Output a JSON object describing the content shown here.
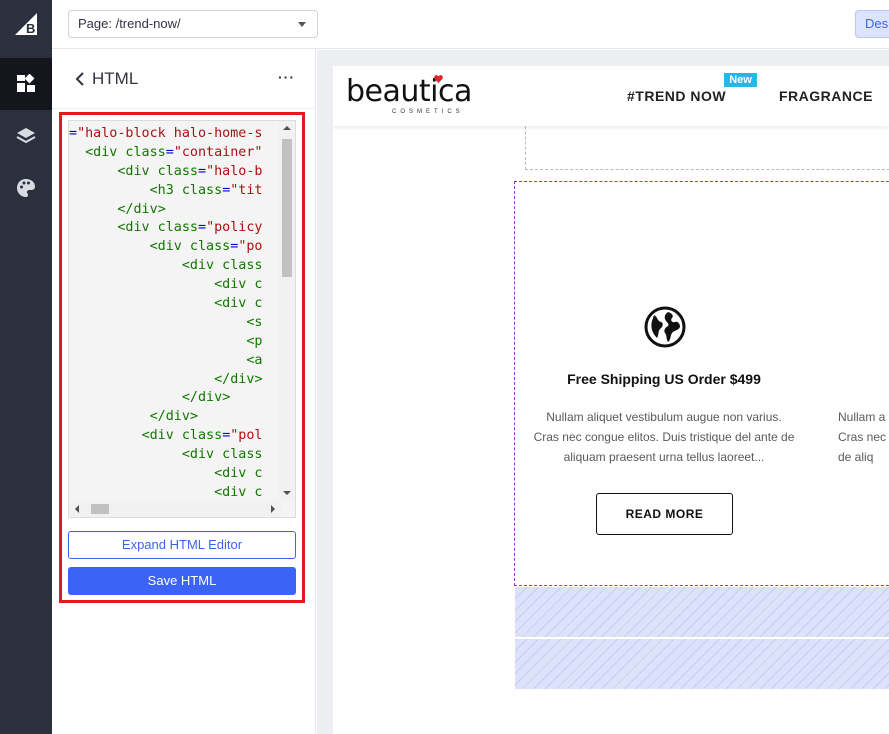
{
  "topbar": {
    "page_select": "Page: /trend-now/",
    "design_button": "Desi"
  },
  "rail": {
    "items": [
      {
        "name": "bigcommerce-logo"
      },
      {
        "name": "widgets-icon",
        "active": true
      },
      {
        "name": "layers-icon"
      },
      {
        "name": "palette-icon"
      }
    ]
  },
  "panel": {
    "back_label": "HTML",
    "more": "···",
    "code_lines": [
      "=\"halo-block halo-home-s",
      "  <div class=\"container\"",
      "      <div class=\"halo-b",
      "          <h3 class=\"tit",
      "      </div>",
      "      <div class=\"policy",
      "          <div class=\"po",
      "              <div class",
      "                  <div c",
      "                  <div c",
      "                      <s",
      "                      <p",
      "                      <a",
      "                  </div>",
      "              </div>",
      "          </div>",
      "         <div class=\"pol",
      "              <div class",
      "                  <div c",
      "                  <div c"
    ],
    "expand_button": "Expand HTML Editor",
    "save_button": "Save HTML"
  },
  "preview": {
    "brand": "beautica",
    "brand_sub": "COSMETICS",
    "nav": [
      {
        "label": "#TREND NOW",
        "badge": "New"
      },
      {
        "label": "FRAGRANCE"
      }
    ],
    "policy": {
      "title": "Free Shipping US Order $499",
      "text": "Nullam aliquet vestibulum augue non varius. Cras nec congue elitos. Duis tristique del ante de aliquam praesent urna tellus laoreet...",
      "text_partial": [
        "Nullam a",
        "Cras nec",
        "de aliq"
      ],
      "button": "READ MORE"
    }
  },
  "colors": {
    "rail_bg": "#2c2f3e",
    "accent": "#3c64f4",
    "highlight": "#e01b1b",
    "badge": "#2ab5e8",
    "heart": "#e0242c",
    "selection_dash": "#9b30d9"
  }
}
